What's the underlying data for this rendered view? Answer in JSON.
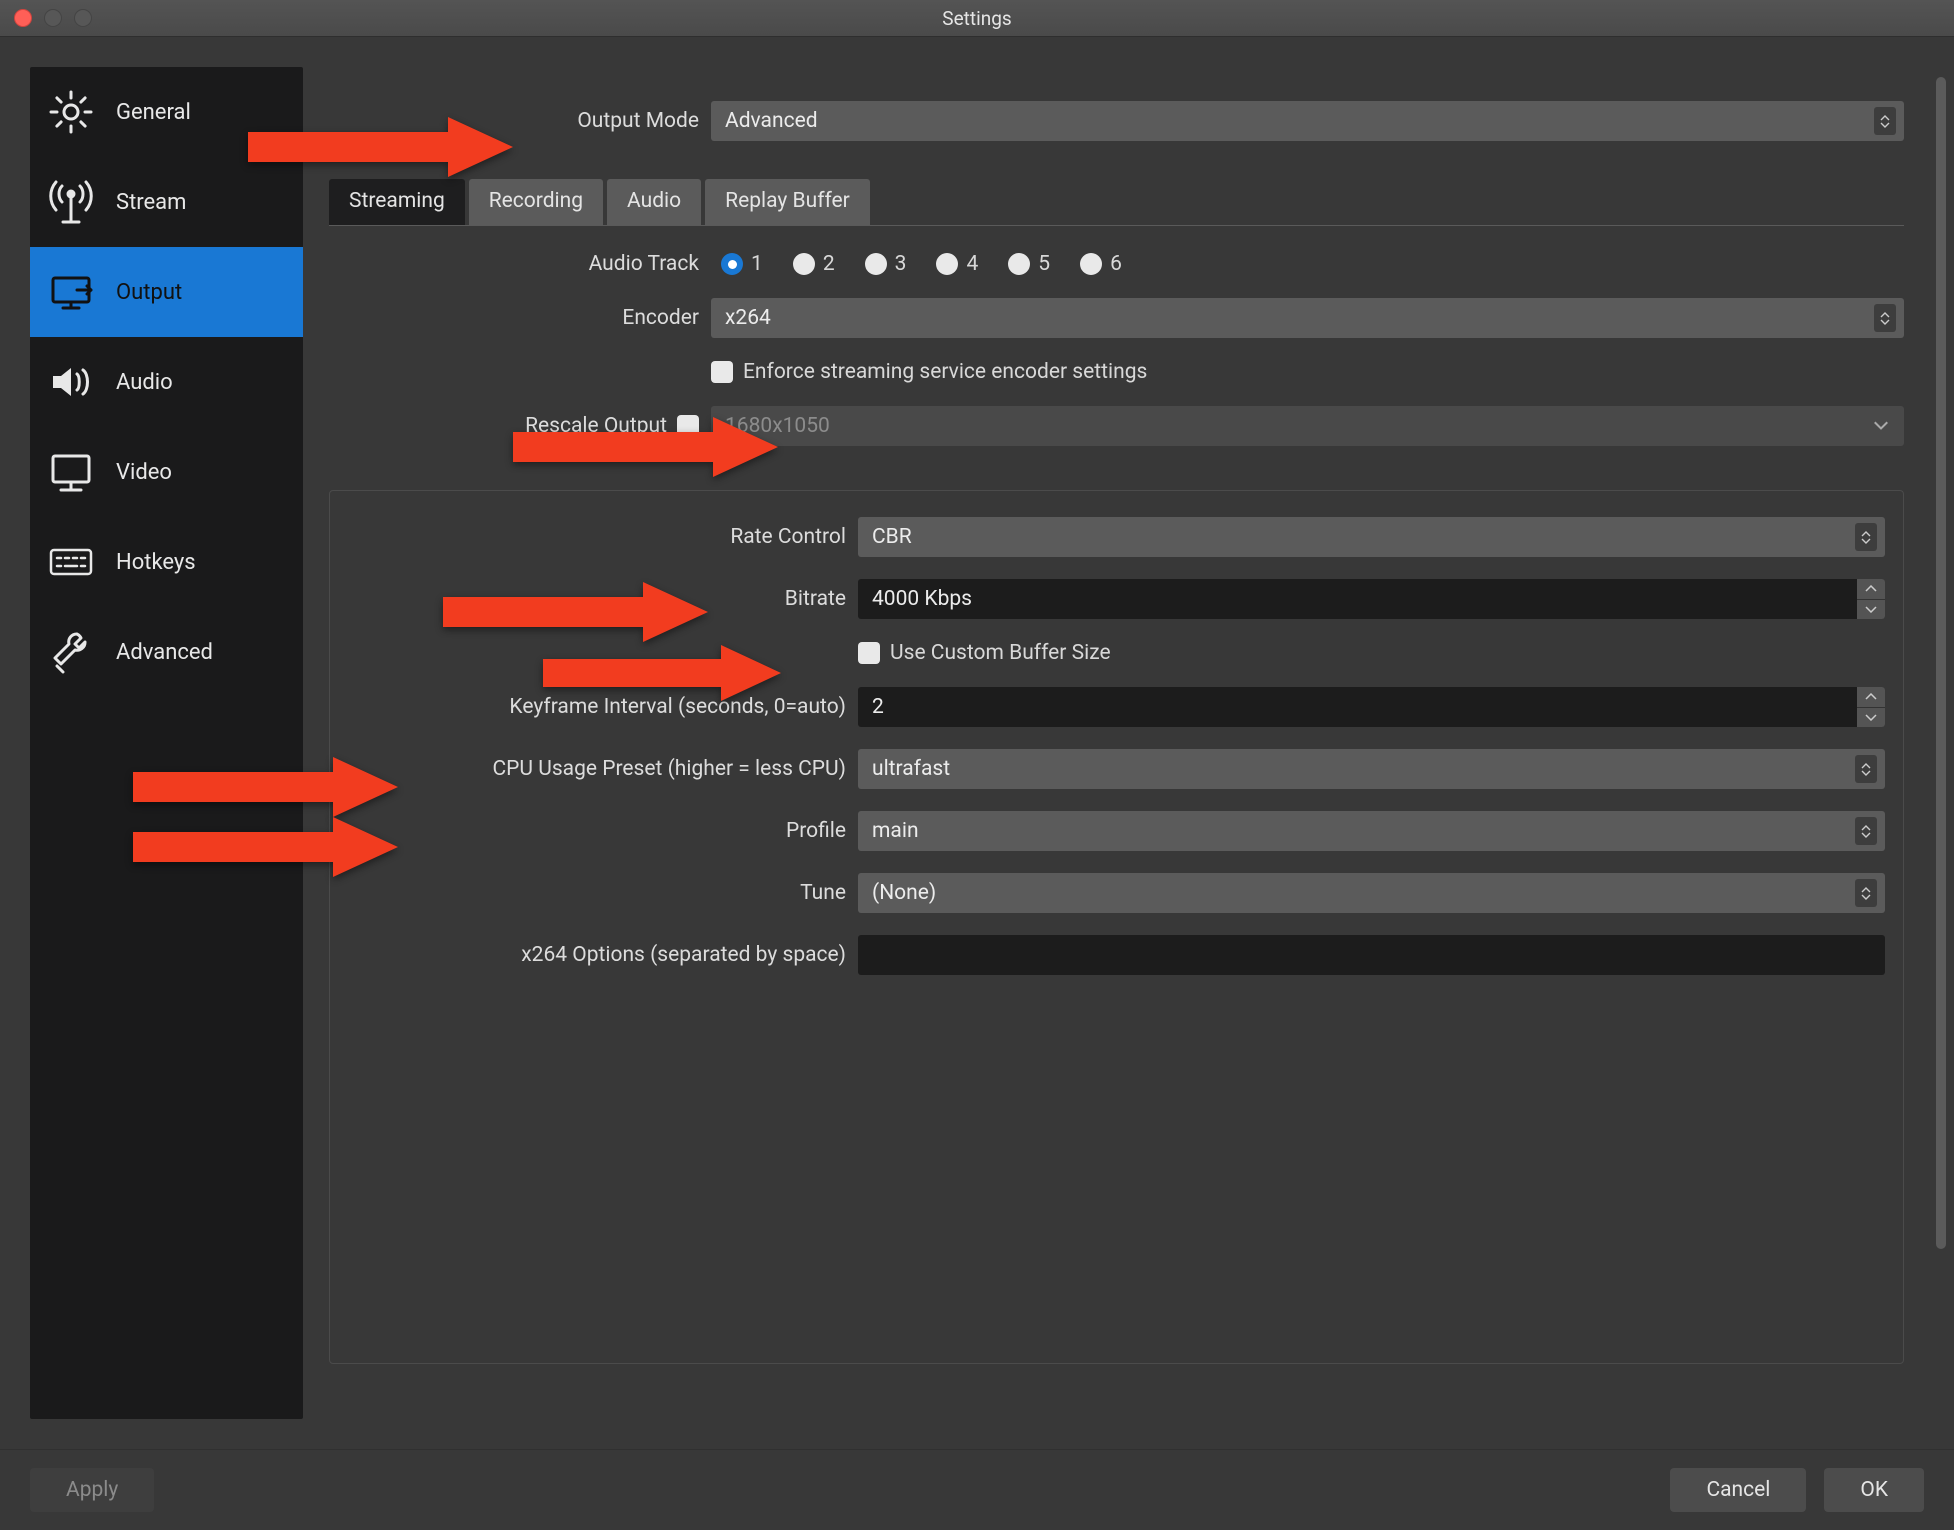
{
  "window": {
    "title": "Settings"
  },
  "sidebar": {
    "items": [
      {
        "label": "General",
        "icon": "gear-icon"
      },
      {
        "label": "Stream",
        "icon": "antenna-icon"
      },
      {
        "label": "Output",
        "icon": "monitor-out-icon",
        "active": true
      },
      {
        "label": "Audio",
        "icon": "speaker-icon"
      },
      {
        "label": "Video",
        "icon": "monitor-icon"
      },
      {
        "label": "Hotkeys",
        "icon": "keyboard-icon"
      },
      {
        "label": "Advanced",
        "icon": "tools-icon"
      }
    ]
  },
  "header": {
    "output_mode_label": "Output Mode",
    "output_mode_value": "Advanced"
  },
  "tabs": [
    {
      "label": "Streaming",
      "active": true
    },
    {
      "label": "Recording"
    },
    {
      "label": "Audio"
    },
    {
      "label": "Replay Buffer"
    }
  ],
  "streaming": {
    "audio_track_label": "Audio Track",
    "audio_track_options": [
      "1",
      "2",
      "3",
      "4",
      "5",
      "6"
    ],
    "audio_track_selected": "1",
    "encoder_label": "Encoder",
    "encoder_value": "x264",
    "enforce_label": "Enforce streaming service encoder settings",
    "enforce_checked": false,
    "rescale_label": "Rescale Output",
    "rescale_checked": false,
    "rescale_placeholder": "1680x1050"
  },
  "encoder": {
    "rate_control_label": "Rate Control",
    "rate_control_value": "CBR",
    "bitrate_label": "Bitrate",
    "bitrate_value": "4000 Kbps",
    "custom_buffer_label": "Use Custom Buffer Size",
    "custom_buffer_checked": false,
    "keyframe_label": "Keyframe Interval (seconds, 0=auto)",
    "keyframe_value": "2",
    "cpu_preset_label": "CPU Usage Preset (higher = less CPU)",
    "cpu_preset_value": "ultrafast",
    "profile_label": "Profile",
    "profile_value": "main",
    "tune_label": "Tune",
    "tune_value": "(None)",
    "x264_opts_label": "x264 Options (separated by space)",
    "x264_opts_value": ""
  },
  "footer": {
    "apply": "Apply",
    "cancel": "Cancel",
    "ok": "OK"
  },
  "annotations": {
    "color": "#f23c1f"
  }
}
